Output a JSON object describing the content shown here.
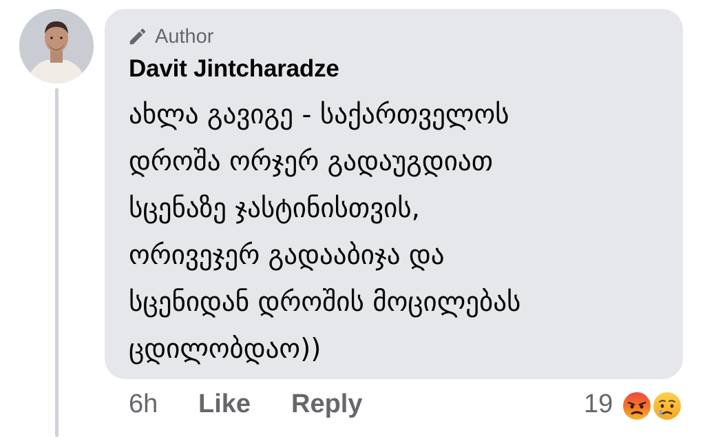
{
  "comment": {
    "badge_icon": "pencil-icon",
    "badge_label": "Author",
    "author_name": "Davit Jintcharadze",
    "text_lines": [
      "ახლა გავიგე - საქართველოს",
      "დროშა ორჯერ გადაუგდიათ",
      "სცენაზე ჯასტინისთვის,",
      "ორივეჯერ გადააბიჯა და",
      "სცენიდან დროშის მოცილებას",
      "ცდილობდაო))"
    ],
    "bubble_color": "#e6e7eb"
  },
  "footer": {
    "timestamp": "6h",
    "like_label": "Like",
    "reply_label": "Reply",
    "reaction_count": "19",
    "reactions": [
      "angry-emoji-icon",
      "sad-emoji-icon"
    ]
  },
  "colors": {
    "secondary_text": "#65676b",
    "primary_text": "#050505",
    "angry": "#e9710f",
    "sad": "#f7b125"
  }
}
